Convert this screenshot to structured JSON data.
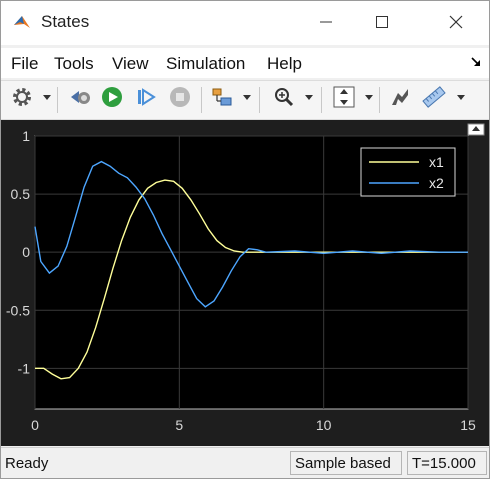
{
  "window": {
    "title": "States"
  },
  "menu": {
    "items": [
      "File",
      "Tools",
      "View",
      "Simulation",
      "Help"
    ]
  },
  "toolbar": {
    "buttons": [
      "gear-icon",
      "step-back-icon",
      "run-icon",
      "step-forward-icon",
      "stop-icon",
      "signal-select-icon",
      "zoom-icon",
      "scale-axes-icon",
      "style-icon",
      "measurement-icon"
    ]
  },
  "colors": {
    "x1": "#ffff99",
    "x2": "#4da6ff",
    "plot_bg": "#000000",
    "axes_bg": "#1e1e1e"
  },
  "chart_data": {
    "type": "line",
    "title": "",
    "xlabel": "",
    "ylabel": "",
    "xlim": [
      0,
      15
    ],
    "ylim": [
      -1.35,
      1.0
    ],
    "xticks": [
      "0",
      "5",
      "10",
      "15"
    ],
    "yticks": [
      "1",
      "0.5",
      "0",
      "-0.5",
      "-1"
    ],
    "grid": true,
    "legend": "top-right",
    "series": [
      {
        "name": "x1",
        "x": [
          0,
          0.3,
          0.6,
          0.9,
          1.2,
          1.5,
          1.8,
          2.1,
          2.4,
          2.7,
          3.0,
          3.3,
          3.6,
          3.9,
          4.2,
          4.5,
          4.8,
          5.1,
          5.4,
          5.7,
          6.0,
          6.3,
          6.6,
          6.9,
          7.2,
          7.5,
          8.0,
          9.0,
          10.0,
          11.0,
          12.0,
          13.0,
          14.0,
          15.0
        ],
        "y": [
          -1.0,
          -1.0,
          -1.05,
          -1.09,
          -1.08,
          -1.0,
          -0.86,
          -0.65,
          -0.4,
          -0.14,
          0.1,
          0.3,
          0.45,
          0.55,
          0.6,
          0.62,
          0.61,
          0.55,
          0.45,
          0.33,
          0.2,
          0.1,
          0.04,
          0.01,
          0.0,
          0.0,
          0.0,
          0.0,
          0.0,
          0.0,
          0.0,
          0.0,
          0.0,
          0.0
        ]
      },
      {
        "name": "x2",
        "x": [
          0,
          0.2,
          0.5,
          0.8,
          1.1,
          1.4,
          1.7,
          2.0,
          2.3,
          2.6,
          2.9,
          3.2,
          3.5,
          3.8,
          4.1,
          4.4,
          4.7,
          5.0,
          5.3,
          5.6,
          5.9,
          6.2,
          6.5,
          6.8,
          7.1,
          7.4,
          7.7,
          8.0,
          9.0,
          10.0,
          11.0,
          12.0,
          13.0,
          14.0,
          15.0
        ],
        "y": [
          0.22,
          -0.08,
          -0.18,
          -0.12,
          0.05,
          0.3,
          0.56,
          0.74,
          0.78,
          0.74,
          0.68,
          0.64,
          0.56,
          0.46,
          0.32,
          0.16,
          0.02,
          -0.12,
          -0.26,
          -0.4,
          -0.47,
          -0.42,
          -0.3,
          -0.16,
          -0.04,
          0.03,
          0.02,
          0.0,
          0.01,
          -0.01,
          0.01,
          -0.01,
          0.01,
          0.0,
          0.0
        ]
      }
    ]
  },
  "status": {
    "ready": "Ready",
    "mode": "Sample based",
    "time": "T=15.000"
  }
}
